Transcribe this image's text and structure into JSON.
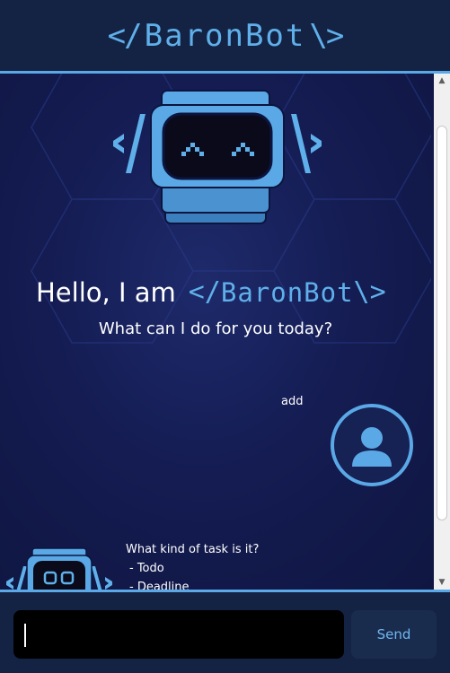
{
  "app": {
    "brand_open": "</",
    "brand_name": "BaronBot",
    "brand_close": "\\>"
  },
  "welcome": {
    "greeting": "Hello, I am",
    "brand_open": "</",
    "brand_name": "BaronBot",
    "brand_close": "\\>",
    "subtitle": "What can I do for you today?"
  },
  "messages": {
    "user": {
      "text": "add"
    },
    "bot": {
      "question": "What kind of task is it?",
      "options": [
        "- Todo",
        "- Deadline"
      ]
    }
  },
  "composer": {
    "input_value": "",
    "input_placeholder": "",
    "send_label": "Send"
  },
  "icons": {
    "bot": "robot-icon",
    "user": "user-avatar-icon",
    "scroll_up": "chevron-up-icon",
    "scroll_down": "chevron-down-icon"
  },
  "colors": {
    "accent": "#5aa8e6",
    "header_bg": "#142344",
    "chat_bg": "#141c52",
    "input_bg": "#000000",
    "send_bg": "#1a2c4e",
    "text": "#ffffff"
  }
}
